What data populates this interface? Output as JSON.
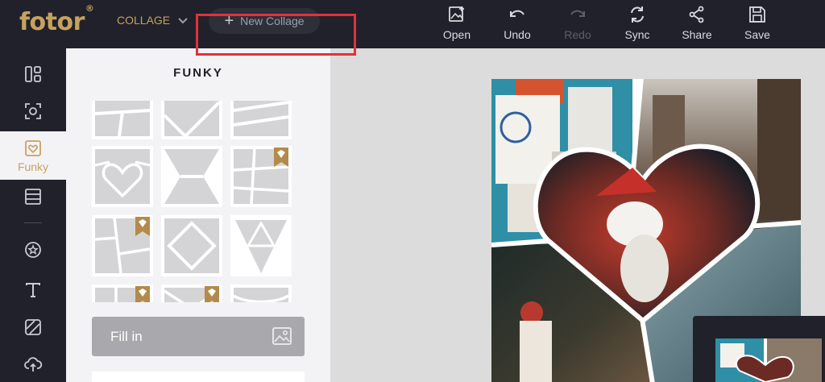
{
  "header": {
    "logo": "fotor",
    "logo_mark": "®",
    "mode": "COLLAGE",
    "new_collage": "New Collage"
  },
  "toolbar": {
    "open": "Open",
    "undo": "Undo",
    "redo": "Redo",
    "sync": "Sync",
    "share": "Share",
    "save": "Save"
  },
  "sidebar": {
    "active_label": "Funky"
  },
  "panel": {
    "title": "FUNKY",
    "fill_in": "Fill in"
  },
  "colors": {
    "brand_gold": "#c7a25e",
    "dark_bg": "#20212a",
    "annotation_red": "#e0323b"
  }
}
